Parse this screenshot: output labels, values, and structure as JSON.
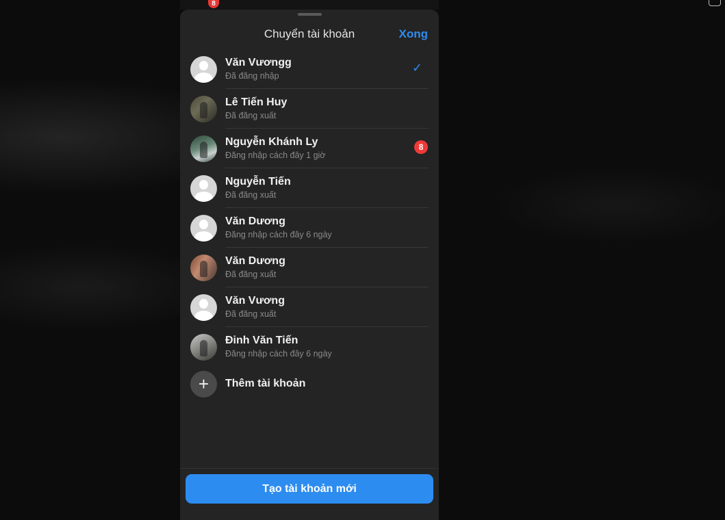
{
  "background": {
    "top_badge_count": "8"
  },
  "sheet": {
    "title": "Chuyển tài khoản",
    "done_label": "Xong",
    "accent_color": "#2d8cf0",
    "accounts": [
      {
        "name": "Văn Vươngg",
        "status": "Đã đăng nhập",
        "avatar": "default-avatar",
        "selected": true,
        "badge": ""
      },
      {
        "name": "Lê Tiến Huy",
        "status": "Đã đăng xuất",
        "avatar": "photo-avatar",
        "selected": false,
        "badge": ""
      },
      {
        "name": "Nguyễn Khánh Ly",
        "status": "Đăng nhập cách đây 1 giờ",
        "avatar": "photo-avatar",
        "selected": false,
        "badge": "8"
      },
      {
        "name": "Nguyễn Tiến",
        "status": "Đã đăng xuất",
        "avatar": "default-avatar",
        "selected": false,
        "badge": ""
      },
      {
        "name": "Văn Dương",
        "status": "Đăng nhập cách đây 6 ngày",
        "avatar": "default-avatar",
        "selected": false,
        "badge": ""
      },
      {
        "name": "Văn Dương",
        "status": "Đã đăng xuất",
        "avatar": "photo-avatar",
        "selected": false,
        "badge": ""
      },
      {
        "name": "Văn Vương",
        "status": "Đã đăng xuất",
        "avatar": "default-avatar",
        "selected": false,
        "badge": ""
      },
      {
        "name": "Đinh Văn Tiến",
        "status": "Đăng nhập cách đây 6 ngày",
        "avatar": "photo-avatar",
        "selected": false,
        "badge": ""
      }
    ],
    "add_account_label": "Thêm tài khoản",
    "create_account_label": "Tạo tài khoản mới"
  }
}
